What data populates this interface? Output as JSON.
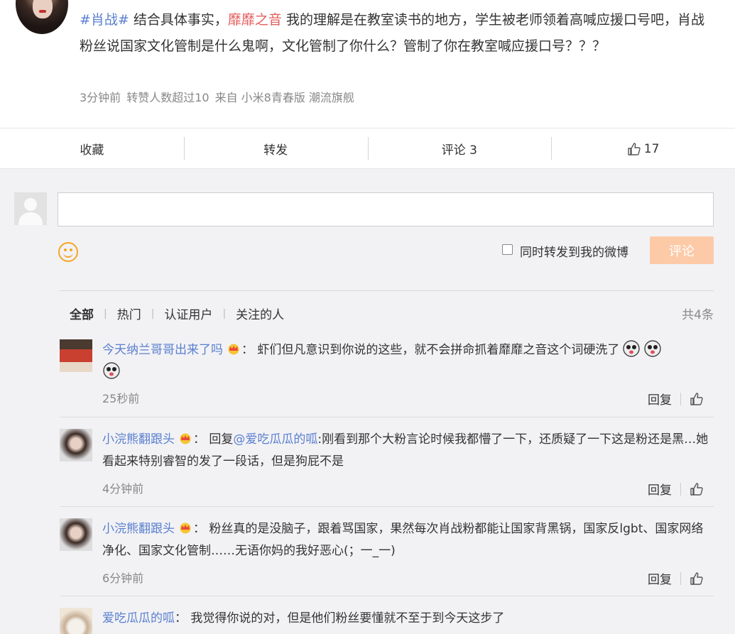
{
  "post": {
    "tag": "#肖战#",
    "text_before_mention": " 结合具体事实，",
    "mention": "靡靡之音",
    "text_after_mention": " 我的理解是在教室读书的地方，学生被老师领着高喊应援口号吧，肖战粉丝说国家文化管制是什么鬼啊，文化管制了你什么？管制了你在教室喊应援口号？？？",
    "time": "3分钟前",
    "repost_info": "转赞人数超过10",
    "source": "来自 小米8青春版 潮流旗舰"
  },
  "actions": {
    "favorite": "收藏",
    "forward": "转发",
    "comment": "评论 3",
    "like_count": "17"
  },
  "compose": {
    "forward_label": "同时转发到我的微博",
    "submit_label": "评论"
  },
  "filters": {
    "tabs": [
      "全部",
      "热门",
      "认证用户",
      "关注的人"
    ],
    "total": "共4条"
  },
  "comments": [
    {
      "user": "今天纳兰哥哥出来了吗",
      "text": "：  虾们但凡意识到你说的这些，就不会拼命抓着靡靡之音这个词硬洗了",
      "time": "25秒前",
      "reply": "回复"
    },
    {
      "user": "小浣熊翻跟头",
      "prefix": "：  回复",
      "reply_to": "@爱吃瓜瓜的呱",
      "text": ":刚看到那个大粉言论时候我都懵了一下，还质疑了一下这是粉还是黑…她看起来特别睿智的发了一段话，但是狗屁不是",
      "time": "4分钟前",
      "reply": "回复"
    },
    {
      "user": "小浣熊翻跟头",
      "text": "：  粉丝真的是没脑子，跟着骂国家，果然每次肖战粉都能让国家背黑锅，国家反lgbt、国家网络净化、国家文化管制……无语你妈的我好恶心(；一_一)",
      "time": "6分钟前",
      "reply": "回复"
    },
    {
      "user": "爱吃瓜瓜的呱",
      "text": "：  我觉得你说的对，但是他们粉丝要懂就不至于到今天这步了"
    }
  ],
  "colors": {
    "link_blue": "#5a7fcf",
    "mention_red": "#e45c5c",
    "submit_disabled": "#fdcaa8",
    "emoji_orange": "#f5a623"
  }
}
